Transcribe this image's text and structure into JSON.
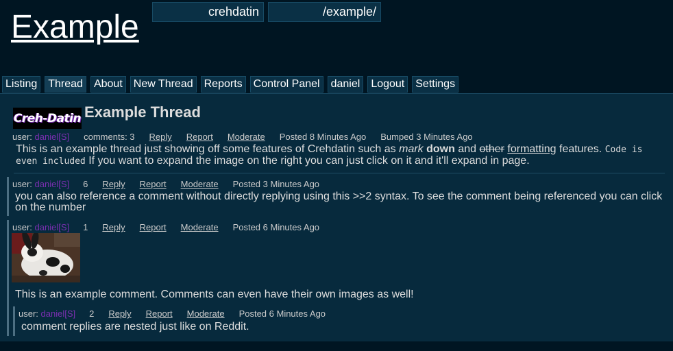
{
  "site": {
    "logo": "Example"
  },
  "path": {
    "board": "crehdatin",
    "sub": "/example/"
  },
  "nav": [
    "Listing",
    "Thread",
    "About",
    "New Thread",
    "Reports",
    "Control Panel",
    "daniel",
    "Logout",
    "Settings"
  ],
  "thread": {
    "thumb_text": "Creh-Datin",
    "title": "Example Thread",
    "user_label": "user:",
    "user_name": "daniel[S]",
    "comments": "comments: 3",
    "reply": "Reply",
    "report": "Report",
    "moderate": "Moderate",
    "posted": "Posted 8 Minutes Ago",
    "bumped": "Bumped 3 Minutes Ago",
    "body": {
      "t1": "This is an example thread just showing off some features of Crehdatin such as ",
      "mark": "mark",
      "t2": " ",
      "down": "down",
      "t3": " and ",
      "other": "other",
      "t4": " ",
      "formatting": "formatting",
      "t5": " features. ",
      "code": "Code is even included",
      "t6": " If you want to expand the image on the right you can just click on it and it'll expand in page."
    }
  },
  "comments": [
    {
      "user_label": "user:",
      "user_name": "daniel[S]",
      "num": "6",
      "reply": "Reply",
      "report": "Report",
      "moderate": "Moderate",
      "posted": "Posted 3 Minutes Ago",
      "text": "you can also reference a comment without directly replying using this >>2 syntax. To see the comment being referenced you can click on the number"
    },
    {
      "user_label": "user:",
      "user_name": "daniel[S]",
      "num": "1",
      "reply": "Reply",
      "report": "Report",
      "moderate": "Moderate",
      "posted": "Posted 6 Minutes Ago",
      "text": "This is an example comment. Comments can even have their own images as well!"
    },
    {
      "user_label": "user:",
      "user_name": "daniel[S]",
      "num": "2",
      "reply": "Reply",
      "report": "Report",
      "moderate": "Moderate",
      "posted": "Posted 6 Minutes Ago",
      "text": "comment replies are nested just like on Reddit."
    }
  ]
}
